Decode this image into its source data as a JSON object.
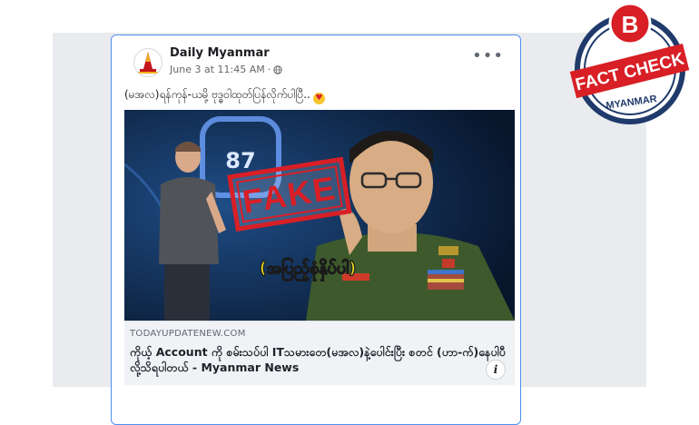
{
  "post": {
    "page_name": "Daily Myanmar",
    "timestamp": "June 3 at 11:45 AM",
    "visibility_icon": "globe-icon",
    "caption": "(မအလ)ရန်ကုန်-ယမို့ ဗုဒ္ဓဝါထုတ်ပြန်လိုက်ပါပြီ..",
    "caption_emoji": "heart-eyes-emoji"
  },
  "image": {
    "stamp_text": "FAKE",
    "overlay_text": "(အပြည့်စုံနှိပ်ပါ)",
    "screen_number": "87"
  },
  "link_preview": {
    "domain": "TODAYUPDATENEW.COM",
    "title": "ကိုယ့် Account ကို စမ်းသပ်ပါ ITသမားတေ(မအလ)နဲ့ပေါင်းပြီး စတင် (ဟာ-က်)နေပါပီလို့သိရပါတယ် - Myanmar News"
  },
  "badge": {
    "letter": "B",
    "line1": "FACT CHECK",
    "line2": "MYANMAR"
  },
  "colors": {
    "stamp_red": "#d81f26",
    "overlay_yellow": "#f5e31a",
    "link_highlight": "#4d8ff0"
  }
}
